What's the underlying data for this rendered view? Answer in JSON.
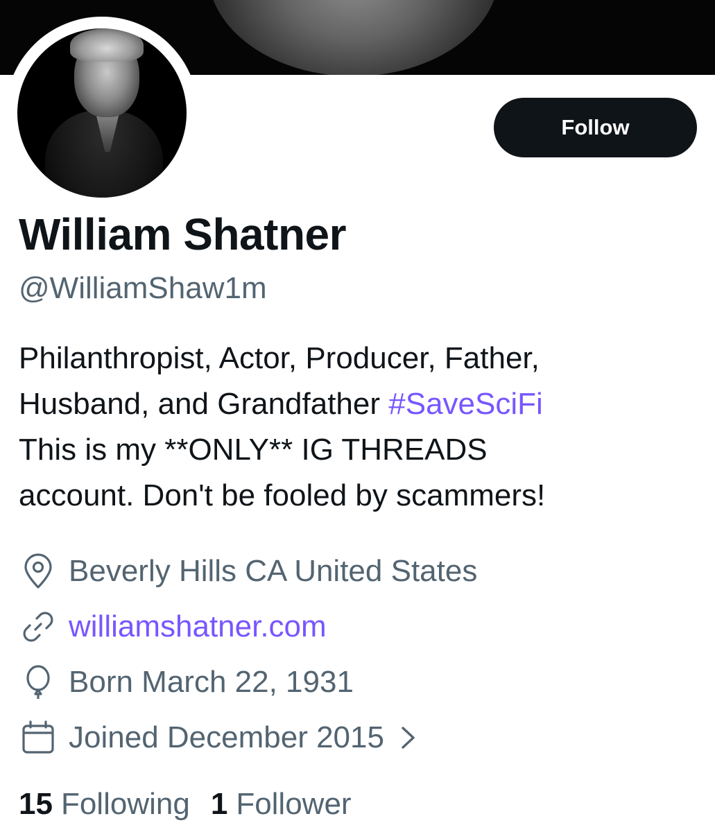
{
  "profile": {
    "display_name": "William Shatner",
    "handle": "@WilliamShaw1m",
    "follow_label": "Follow",
    "bio": {
      "line1": "Philanthropist, Actor, Producer, Father,",
      "line2_text": "Husband, and Grandfather ",
      "line2_hashtag": "#SaveSciFi",
      "line3": "This is my **ONLY** IG THREADS",
      "line4": "account. Don't be fooled by scammers!"
    },
    "location": "Beverly Hills CA United States",
    "website": "williamshatner.com",
    "born": "Born March 22, 1931",
    "joined": "Joined December 2015",
    "stats": {
      "following_count": "15",
      "following_label": "Following",
      "followers_count": "1",
      "followers_label": "Follower"
    }
  },
  "icons": {
    "location": "location-pin-icon",
    "website": "link-icon",
    "born": "balloon-icon",
    "joined": "calendar-icon",
    "joined_chevron": "chevron-right-icon"
  },
  "colors": {
    "accent": "#7856ff",
    "primary_text": "#0f1419",
    "secondary_text": "#536471",
    "button_bg": "#0f1419",
    "button_text": "#ffffff"
  }
}
